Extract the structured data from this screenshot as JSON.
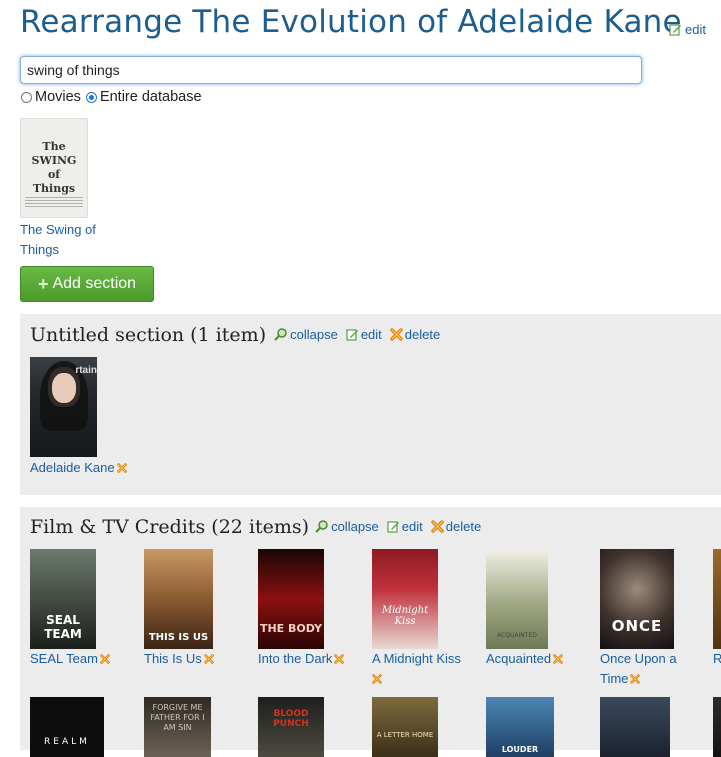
{
  "header": {
    "title": "Rearrange The Evolution of Adelaide Kane",
    "edit_label": "edit"
  },
  "search": {
    "value": "swing of things",
    "scope_options": [
      "Movies",
      "Entire database"
    ],
    "scope_selected": "Entire database"
  },
  "search_result": {
    "title": "The Swing of Things",
    "poster_text": "The SWING of Things"
  },
  "add_section_label": "Add section",
  "colors": {
    "accent": "#1a5ea0",
    "title": "#1d5e8f",
    "add_button": "#58a836",
    "section_bg": "#ececec"
  },
  "sections": [
    {
      "title": "Untitled section (1 item)",
      "actions": [
        "collapse",
        "edit",
        "delete"
      ],
      "items": [
        {
          "label": "Adelaide Kane"
        }
      ]
    },
    {
      "title": "Film & TV Credits (22 items)",
      "actions": [
        "collapse",
        "edit",
        "delete"
      ],
      "items": [
        {
          "label": "SEAL Team",
          "poster_text": "SEAL TEAM"
        },
        {
          "label": "This Is Us",
          "poster_text": "THIS IS US"
        },
        {
          "label": "Into the Dark",
          "poster_text": "THE BODY"
        },
        {
          "label": "A Midnight Kiss",
          "poster_text": "Midnight Kiss"
        },
        {
          "label": "Acquainted",
          "poster_text": "ACQUAINTED"
        },
        {
          "label": "Once Upon a Time",
          "poster_text": "ONCE"
        },
        {
          "label": "R"
        }
      ],
      "row2_poster_texts": [
        "REALM",
        "FORGIVE ME FATHER FOR I AM SIN",
        "BLOOD PUNCH",
        "A LETTER HOME",
        "LOUDER",
        ""
      ]
    }
  ]
}
